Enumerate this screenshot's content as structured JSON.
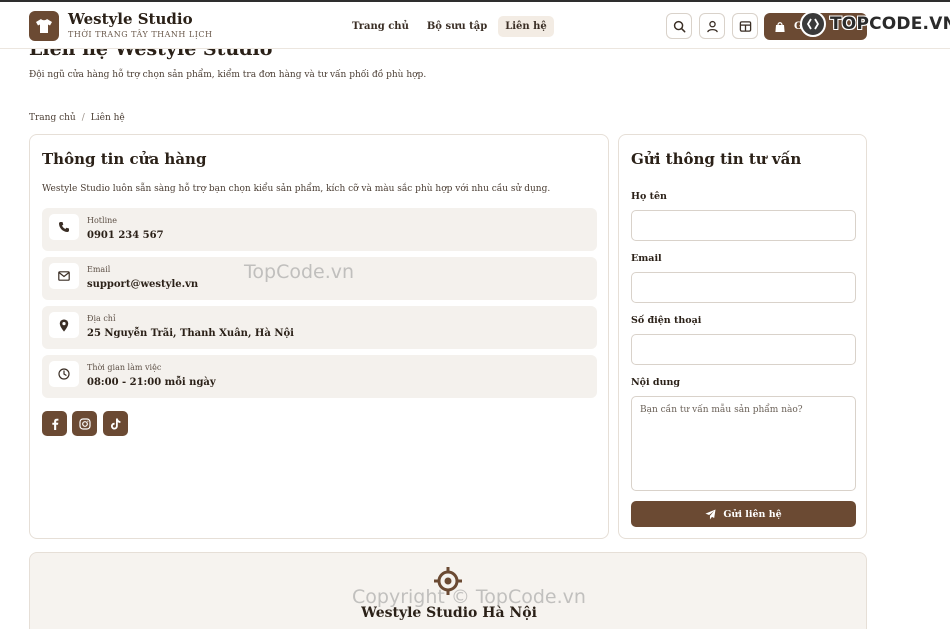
{
  "header": {
    "brand_name": "Westyle Studio",
    "brand_tagline": "THỜI TRANG TÂY THANH LỊCH",
    "nav": [
      {
        "label": "Trang chủ",
        "active": false
      },
      {
        "label": "Bộ sưu tập",
        "active": false
      },
      {
        "label": "Liên hệ",
        "active": true
      }
    ],
    "cart_label": "G",
    "icons": [
      "search-icon",
      "user-icon",
      "layout-icon",
      "bag-icon"
    ]
  },
  "watermark_logo": "TOPCODE.VN",
  "page": {
    "title": "Liên hệ Westyle Studio",
    "subtitle": "Đội ngũ cửa hàng hỗ trợ chọn sản phẩm, kiểm tra đơn hàng và tư vấn phối đồ phù hợp.",
    "breadcrumb": [
      "Trang chủ",
      "Liên hệ"
    ]
  },
  "store_info": {
    "title": "Thông tin cửa hàng",
    "description": "Westyle Studio luôn sẵn sàng hỗ trợ bạn chọn kiểu sản phẩm, kích cỡ và màu sắc phù hợp với nhu cầu sử dụng.",
    "items": [
      {
        "icon": "phone-icon",
        "label": "Hotline",
        "value": "0901 234 567"
      },
      {
        "icon": "envelope-icon",
        "label": "Email",
        "value": "support@westyle.vn"
      },
      {
        "icon": "location-pin-icon",
        "label": "Địa chỉ",
        "value": "25 Nguyễn Trãi, Thanh Xuân, Hà Nội"
      },
      {
        "icon": "clock-icon",
        "label": "Thời gian làm việc",
        "value": "08:00 - 21:00 mỗi ngày"
      }
    ],
    "socials": [
      "facebook-icon",
      "instagram-icon",
      "tiktok-icon"
    ]
  },
  "form": {
    "title": "Gửi thông tin tư vấn",
    "name_label": "Họ tên",
    "name_value": "",
    "email_label": "Email",
    "email_value": "",
    "phone_label": "Số điện thoại",
    "phone_value": "",
    "message_label": "Nội dung",
    "message_placeholder": "Bạn cần tư vấn mẫu sản phẩm nào?",
    "submit_label": "Gửi liên hệ"
  },
  "map": {
    "title": "Westyle Studio Hà Nội"
  },
  "watermarks": [
    "TopCode.vn",
    "Copyright © TopCode.vn"
  ],
  "colors": {
    "brand": "#6b4a33",
    "card_bg": "#f4f1ed",
    "border": "#e6dfd7",
    "text": "#2b2118"
  }
}
